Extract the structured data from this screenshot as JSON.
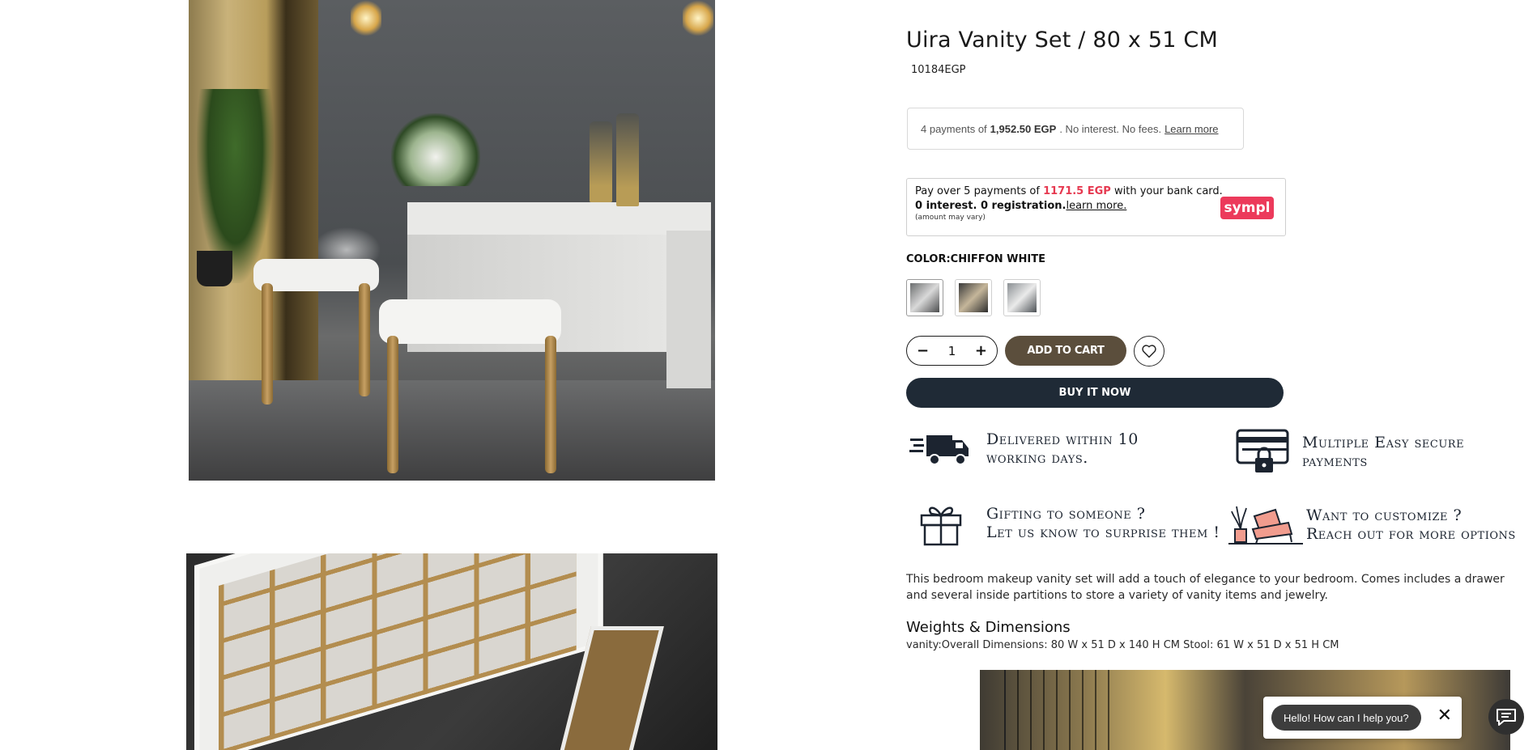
{
  "product": {
    "title": "Uira Vanity Set / 80 x 51 CM",
    "price": "10184EGP"
  },
  "installments": {
    "prefix": "4 payments of",
    "amount": "1,952.50 EGP",
    "suffix": ". No interest. No fees.",
    "link": "Learn more"
  },
  "sympl": {
    "line1_prefix": "Pay over 5 payments of",
    "line1_amount": "1171.5 EGP",
    "line1_suffix": "with your bank card.",
    "line2": "0 interest. 0 registration.",
    "line2_link": "learn more.",
    "line3": "(amount may vary)",
    "logo": "sympl",
    "accent": "#ec3a5b"
  },
  "color": {
    "label": "COLOR:CHIFFON WHITE",
    "swatches": [
      "chiffon-white",
      "swatch-2",
      "swatch-3"
    ]
  },
  "cart": {
    "quantity": "1",
    "minus": "−",
    "plus": "+",
    "add_label": "ADD TO CART",
    "buy_label": "BUY IT NOW",
    "add_color": "#5b4e3c",
    "buy_color": "#1f2a36"
  },
  "features": [
    {
      "line1": "Delivered within 10",
      "line2": "working days.",
      "icon": "delivery-truck-icon"
    },
    {
      "line1": "Multiple Easy secure",
      "line2": "payments",
      "icon": "secure-payment-icon"
    },
    {
      "line1": "Gifting to someone ?",
      "line2": "Let us know to surprise them !",
      "icon": "gift-icon"
    },
    {
      "line1": "Want to customize ?",
      "line2": "Reach out for more options",
      "icon": "armchair-icon"
    }
  ],
  "description": "This bedroom makeup vanity set will add a touch of elegance to your bedroom. Comes includes a drawer and several inside partitions to store a variety of vanity items and jewelry.",
  "weights": {
    "heading": "Weights & Dimensions",
    "text": "vanity:Overall Dimensions: 80 W x 51 D x 140 H CM Stool: 61 W x 51 D x 51 H CM"
  },
  "chat": {
    "greeting": "Hello! How can I help you?",
    "close": "✕"
  }
}
